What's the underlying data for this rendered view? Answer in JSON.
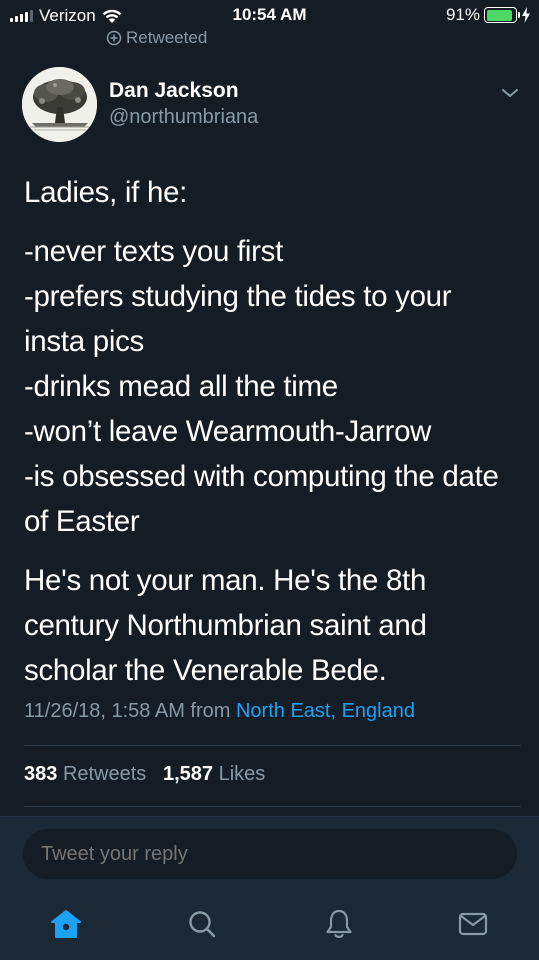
{
  "status_bar": {
    "carrier": "Verizon",
    "time": "10:54 AM",
    "battery_percent": "91%",
    "battery_level": 0.91
  },
  "context": {
    "retweeted_label": "Retweeted"
  },
  "author": {
    "name": "Dan Jackson",
    "handle": "@northumbriana"
  },
  "tweet": {
    "line1": "Ladies, if he:",
    "list": [
      "-never texts you first",
      "-prefers studying the tides to your",
      "insta pics",
      "-drinks mead all the time",
      "-won’t leave Wearmouth-Jarrow",
      "-is obsessed with computing the date",
      "of Easter"
    ],
    "closing": [
      "He's not your man. He's the 8th",
      "century Northumbrian saint and",
      "scholar the Venerable Bede."
    ],
    "timestamp": "11/26/18, 1:58 AM",
    "from_label": "from",
    "location": "North East, England"
  },
  "stats": {
    "retweet_count": "383",
    "retweet_label": "Retweets",
    "like_count": "1,587",
    "like_label": "Likes"
  },
  "reply": {
    "placeholder": "Tweet your reply"
  },
  "tab_bar": {
    "items": [
      {
        "icon": "home-icon",
        "active": true
      },
      {
        "icon": "search-icon",
        "active": false
      },
      {
        "icon": "notifications-icon",
        "active": false
      },
      {
        "icon": "messages-icon",
        "active": false
      }
    ]
  },
  "colors": {
    "background": "#141d26",
    "secondary_text": "#8899a6",
    "accent": "#1da1f2",
    "battery_green": "#4cd964"
  }
}
